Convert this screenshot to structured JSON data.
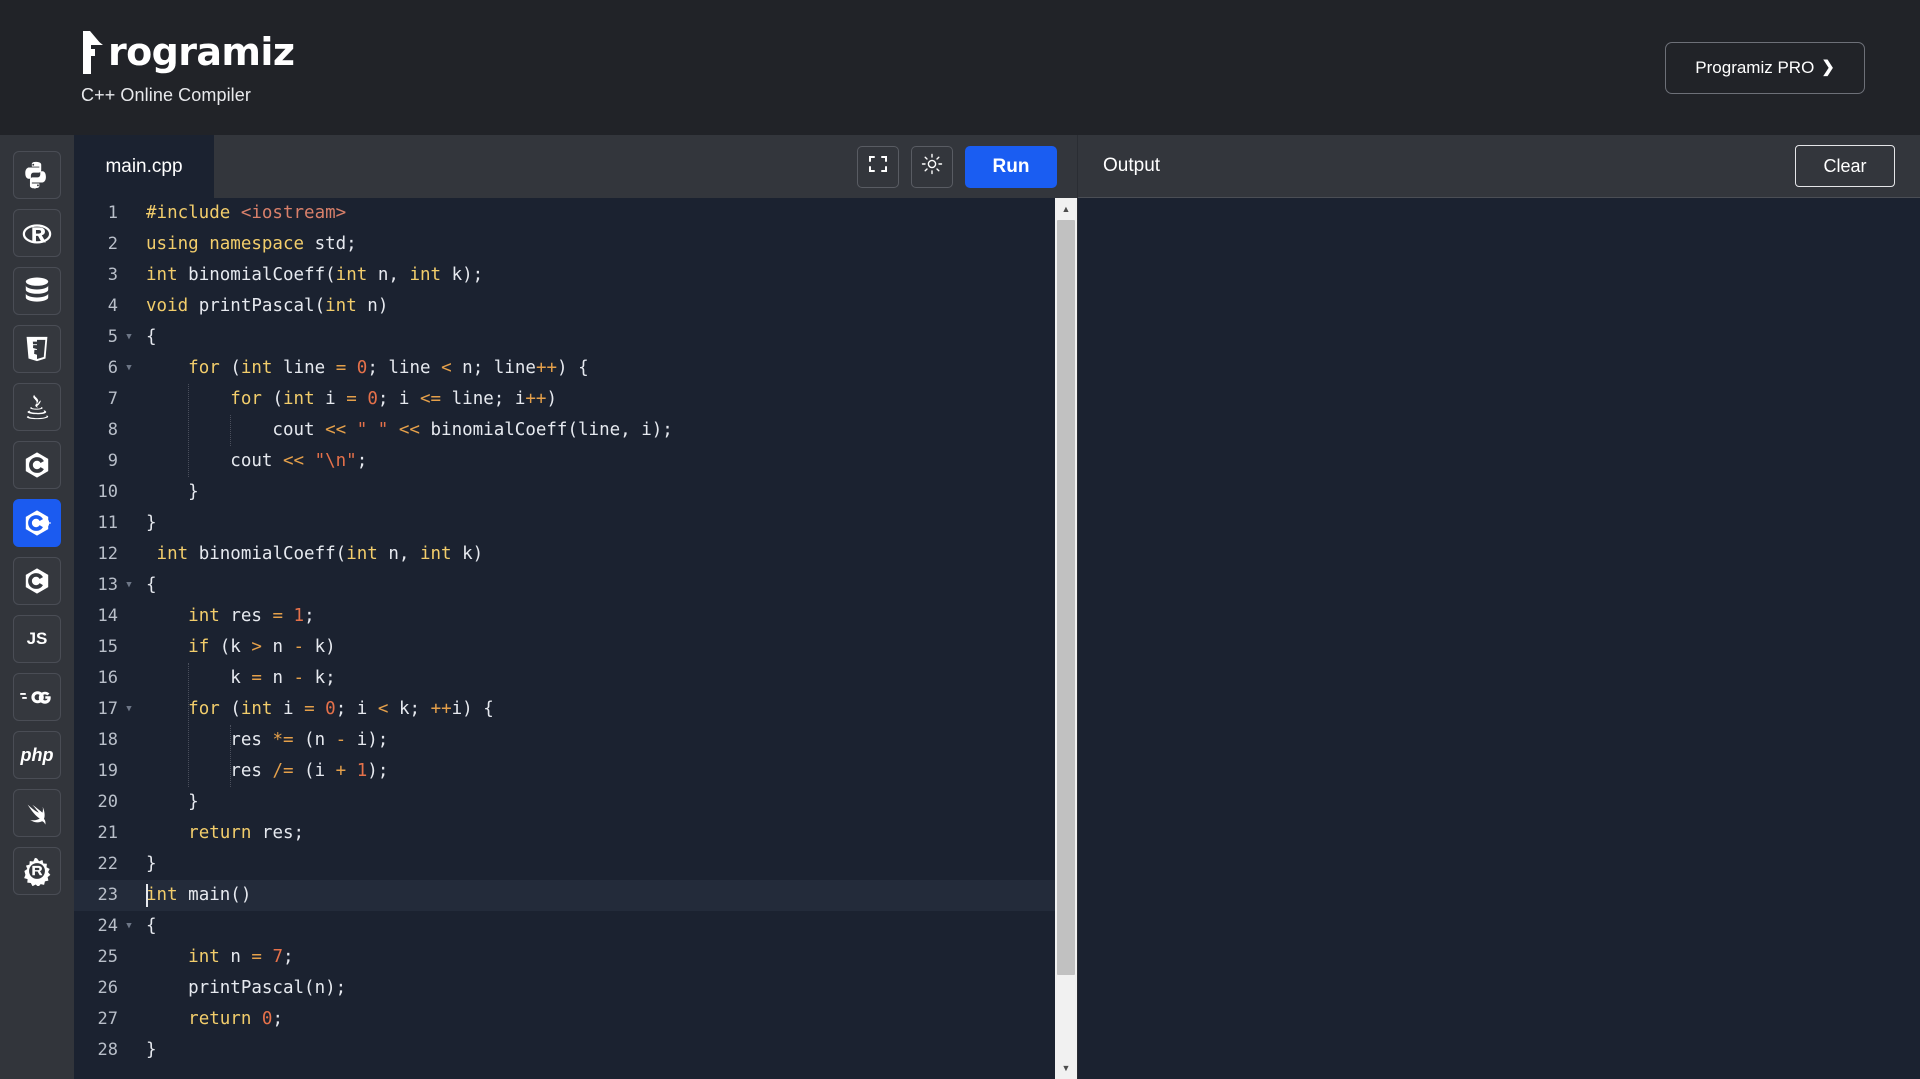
{
  "header": {
    "logo_word": "rogramiz",
    "logo_icon": "programiz-p-logo",
    "subtitle": "C++ Online Compiler",
    "pro_button_label": "Programiz PRO",
    "pro_button_chevron": "❯"
  },
  "sidebar": {
    "items": [
      {
        "name": "python",
        "glyph": "",
        "active": false
      },
      {
        "name": "r",
        "glyph": "",
        "active": false
      },
      {
        "name": "sql",
        "glyph": "",
        "active": false
      },
      {
        "name": "html",
        "glyph": "",
        "active": false
      },
      {
        "name": "java",
        "glyph": "",
        "active": false
      },
      {
        "name": "c",
        "glyph": "",
        "active": false
      },
      {
        "name": "cpp",
        "glyph": "",
        "active": true
      },
      {
        "name": "csharp",
        "glyph": "",
        "active": false
      },
      {
        "name": "javascript",
        "glyph": "JS",
        "active": false
      },
      {
        "name": "go",
        "glyph": "GO",
        "active": false
      },
      {
        "name": "php",
        "glyph": "php",
        "active": false
      },
      {
        "name": "swift",
        "glyph": "",
        "active": false
      },
      {
        "name": "rust",
        "glyph": "",
        "active": false
      }
    ]
  },
  "editor": {
    "tab_label": "main.cpp",
    "fullscreen_icon": "fullscreen-icon",
    "theme_icon": "brightness-icon",
    "run_label": "Run",
    "active_line": 23,
    "total_lines": 28,
    "lines": [
      {
        "n": 1,
        "fold": false,
        "tokens": [
          {
            "t": "#include ",
            "c": "kw"
          },
          {
            "t": "<iostream>",
            "c": "inc"
          }
        ]
      },
      {
        "n": 2,
        "fold": false,
        "tokens": [
          {
            "t": "using namespace ",
            "c": "kw"
          },
          {
            "t": "std;",
            "c": "fn"
          }
        ]
      },
      {
        "n": 3,
        "fold": false,
        "tokens": [
          {
            "t": "int ",
            "c": "kw"
          },
          {
            "t": "binomialCoeff(",
            "c": "fn"
          },
          {
            "t": "int ",
            "c": "kw"
          },
          {
            "t": "n, ",
            "c": "fn"
          },
          {
            "t": "int ",
            "c": "kw"
          },
          {
            "t": "k);",
            "c": "fn"
          }
        ]
      },
      {
        "n": 4,
        "fold": false,
        "tokens": [
          {
            "t": "void ",
            "c": "kw"
          },
          {
            "t": "printPascal(",
            "c": "fn"
          },
          {
            "t": "int ",
            "c": "kw"
          },
          {
            "t": "n)",
            "c": "fn"
          }
        ]
      },
      {
        "n": 5,
        "fold": true,
        "tokens": [
          {
            "t": "{",
            "c": "fn"
          }
        ]
      },
      {
        "n": 6,
        "fold": true,
        "tokens": [
          {
            "t": "    ",
            "c": "fn"
          },
          {
            "t": "for ",
            "c": "kw"
          },
          {
            "t": "(",
            "c": "fn"
          },
          {
            "t": "int ",
            "c": "kw"
          },
          {
            "t": "line ",
            "c": "fn"
          },
          {
            "t": "= ",
            "c": "op"
          },
          {
            "t": "0",
            "c": "num"
          },
          {
            "t": "; line ",
            "c": "fn"
          },
          {
            "t": "< ",
            "c": "op"
          },
          {
            "t": "n; line",
            "c": "fn"
          },
          {
            "t": "++",
            "c": "op"
          },
          {
            "t": ") {",
            "c": "fn"
          }
        ]
      },
      {
        "n": 7,
        "fold": false,
        "tokens": [
          {
            "t": "        ",
            "c": "fn"
          },
          {
            "t": "for ",
            "c": "kw"
          },
          {
            "t": "(",
            "c": "fn"
          },
          {
            "t": "int ",
            "c": "kw"
          },
          {
            "t": "i ",
            "c": "fn"
          },
          {
            "t": "= ",
            "c": "op"
          },
          {
            "t": "0",
            "c": "num"
          },
          {
            "t": "; i ",
            "c": "fn"
          },
          {
            "t": "<= ",
            "c": "op"
          },
          {
            "t": "line; i",
            "c": "fn"
          },
          {
            "t": "++",
            "c": "op"
          },
          {
            "t": ")",
            "c": "fn"
          }
        ]
      },
      {
        "n": 8,
        "fold": false,
        "tokens": [
          {
            "t": "            cout ",
            "c": "fn"
          },
          {
            "t": "<< ",
            "c": "op"
          },
          {
            "t": "\" \" ",
            "c": "str"
          },
          {
            "t": "<< ",
            "c": "op"
          },
          {
            "t": "binomialCoeff(line, i);",
            "c": "fn"
          }
        ]
      },
      {
        "n": 9,
        "fold": false,
        "tokens": [
          {
            "t": "        cout ",
            "c": "fn"
          },
          {
            "t": "<< ",
            "c": "op"
          },
          {
            "t": "\"\\n\"",
            "c": "str"
          },
          {
            "t": ";",
            "c": "fn"
          }
        ]
      },
      {
        "n": 10,
        "fold": false,
        "tokens": [
          {
            "t": "    }",
            "c": "fn"
          }
        ]
      },
      {
        "n": 11,
        "fold": false,
        "tokens": [
          {
            "t": "}",
            "c": "fn"
          }
        ]
      },
      {
        "n": 12,
        "fold": false,
        "tokens": [
          {
            "t": " ",
            "c": "fn"
          },
          {
            "t": "int ",
            "c": "kw"
          },
          {
            "t": "binomialCoeff(",
            "c": "fn"
          },
          {
            "t": "int ",
            "c": "kw"
          },
          {
            "t": "n, ",
            "c": "fn"
          },
          {
            "t": "int ",
            "c": "kw"
          },
          {
            "t": "k)",
            "c": "fn"
          }
        ]
      },
      {
        "n": 13,
        "fold": true,
        "tokens": [
          {
            "t": "{",
            "c": "fn"
          }
        ]
      },
      {
        "n": 14,
        "fold": false,
        "tokens": [
          {
            "t": "    ",
            "c": "fn"
          },
          {
            "t": "int ",
            "c": "kw"
          },
          {
            "t": "res ",
            "c": "fn"
          },
          {
            "t": "= ",
            "c": "op"
          },
          {
            "t": "1",
            "c": "num"
          },
          {
            "t": ";",
            "c": "fn"
          }
        ]
      },
      {
        "n": 15,
        "fold": false,
        "tokens": [
          {
            "t": "    ",
            "c": "fn"
          },
          {
            "t": "if ",
            "c": "kw"
          },
          {
            "t": "(k ",
            "c": "fn"
          },
          {
            "t": "> ",
            "c": "op"
          },
          {
            "t": "n ",
            "c": "fn"
          },
          {
            "t": "- ",
            "c": "op"
          },
          {
            "t": "k)",
            "c": "fn"
          }
        ]
      },
      {
        "n": 16,
        "fold": false,
        "tokens": [
          {
            "t": "        k ",
            "c": "fn"
          },
          {
            "t": "= ",
            "c": "op"
          },
          {
            "t": "n ",
            "c": "fn"
          },
          {
            "t": "- ",
            "c": "op"
          },
          {
            "t": "k;",
            "c": "fn"
          }
        ]
      },
      {
        "n": 17,
        "fold": true,
        "tokens": [
          {
            "t": "    ",
            "c": "fn"
          },
          {
            "t": "for ",
            "c": "kw"
          },
          {
            "t": "(",
            "c": "fn"
          },
          {
            "t": "int ",
            "c": "kw"
          },
          {
            "t": "i ",
            "c": "fn"
          },
          {
            "t": "= ",
            "c": "op"
          },
          {
            "t": "0",
            "c": "num"
          },
          {
            "t": "; i ",
            "c": "fn"
          },
          {
            "t": "< ",
            "c": "op"
          },
          {
            "t": "k; ",
            "c": "fn"
          },
          {
            "t": "++",
            "c": "op"
          },
          {
            "t": "i) {",
            "c": "fn"
          }
        ]
      },
      {
        "n": 18,
        "fold": false,
        "tokens": [
          {
            "t": "        res ",
            "c": "fn"
          },
          {
            "t": "*= ",
            "c": "op"
          },
          {
            "t": "(n ",
            "c": "fn"
          },
          {
            "t": "- ",
            "c": "op"
          },
          {
            "t": "i);",
            "c": "fn"
          }
        ]
      },
      {
        "n": 19,
        "fold": false,
        "tokens": [
          {
            "t": "        res ",
            "c": "fn"
          },
          {
            "t": "/= ",
            "c": "op"
          },
          {
            "t": "(i ",
            "c": "fn"
          },
          {
            "t": "+ ",
            "c": "op"
          },
          {
            "t": "1",
            "c": "num"
          },
          {
            "t": ");",
            "c": "fn"
          }
        ]
      },
      {
        "n": 20,
        "fold": false,
        "tokens": [
          {
            "t": "    }",
            "c": "fn"
          }
        ]
      },
      {
        "n": 21,
        "fold": false,
        "tokens": [
          {
            "t": "    ",
            "c": "fn"
          },
          {
            "t": "return ",
            "c": "kw"
          },
          {
            "t": "res;",
            "c": "fn"
          }
        ]
      },
      {
        "n": 22,
        "fold": false,
        "tokens": [
          {
            "t": "}",
            "c": "fn"
          }
        ]
      },
      {
        "n": 23,
        "fold": false,
        "tokens": [
          {
            "t": "int ",
            "c": "kw"
          },
          {
            "t": "main()",
            "c": "fn"
          }
        ]
      },
      {
        "n": 24,
        "fold": true,
        "tokens": [
          {
            "t": "{",
            "c": "fn"
          }
        ]
      },
      {
        "n": 25,
        "fold": false,
        "tokens": [
          {
            "t": "    ",
            "c": "fn"
          },
          {
            "t": "int ",
            "c": "kw"
          },
          {
            "t": "n ",
            "c": "fn"
          },
          {
            "t": "= ",
            "c": "op"
          },
          {
            "t": "7",
            "c": "num"
          },
          {
            "t": ";",
            "c": "fn"
          }
        ]
      },
      {
        "n": 26,
        "fold": false,
        "tokens": [
          {
            "t": "    printPascal(n);",
            "c": "fn"
          }
        ]
      },
      {
        "n": 27,
        "fold": false,
        "tokens": [
          {
            "t": "    ",
            "c": "fn"
          },
          {
            "t": "return ",
            "c": "kw"
          },
          {
            "t": "0",
            "c": "num"
          },
          {
            "t": ";",
            "c": "fn"
          }
        ]
      },
      {
        "n": 28,
        "fold": false,
        "tokens": [
          {
            "t": "}",
            "c": "fn"
          }
        ]
      }
    ]
  },
  "output": {
    "title": "Output",
    "clear_label": "Clear",
    "content": ""
  },
  "colors": {
    "accent_blue": "#1a5df2",
    "header_bg": "#212328",
    "sidebar_bg": "#32353b",
    "editor_bg": "#1b2230",
    "toolbar_bg": "#33363c",
    "keyword": "#f2cd6b",
    "string": "#e5714a",
    "operator": "#e5a04a",
    "text": "#e6e9ef"
  }
}
